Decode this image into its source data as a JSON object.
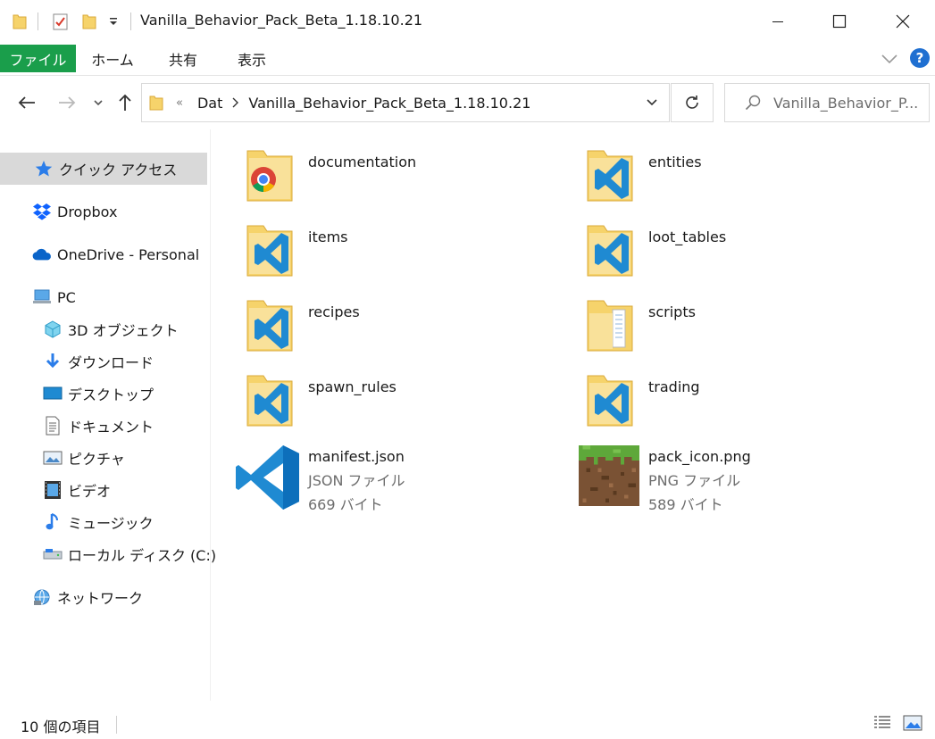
{
  "window": {
    "title": "Vanilla_Behavior_Pack_Beta_1.18.10.21"
  },
  "ribbon": {
    "tabs": [
      "ファイル",
      "ホーム",
      "共有",
      "表示"
    ]
  },
  "address": {
    "overflow": "«",
    "crumbs": [
      "Dat",
      "Vanilla_Behavior_Pack_Beta_1.18.10.21"
    ]
  },
  "search": {
    "placeholder": "Vanilla_Behavior_P..."
  },
  "sidebar": {
    "items": [
      {
        "label": "クイック アクセス",
        "icon": "star-icon"
      },
      {
        "label": "Dropbox",
        "icon": "dropbox-icon"
      },
      {
        "label": "OneDrive - Personal",
        "icon": "onedrive-icon"
      },
      {
        "label": "PC",
        "icon": "pc-icon"
      },
      {
        "label": "3D オブジェクト",
        "icon": "3d-objects-icon"
      },
      {
        "label": "ダウンロード",
        "icon": "download-icon"
      },
      {
        "label": "デスクトップ",
        "icon": "desktop-icon"
      },
      {
        "label": "ドキュメント",
        "icon": "documents-icon"
      },
      {
        "label": "ピクチャ",
        "icon": "pictures-icon"
      },
      {
        "label": "ビデオ",
        "icon": "videos-icon"
      },
      {
        "label": "ミュージック",
        "icon": "music-icon"
      },
      {
        "label": "ローカル ディスク (C:)",
        "icon": "local-disk-icon"
      },
      {
        "label": "ネットワーク",
        "icon": "network-icon"
      }
    ]
  },
  "files": {
    "folders": [
      {
        "name": "documentation",
        "icon": "folder-chrome-icon"
      },
      {
        "name": "entities",
        "icon": "folder-vscode-icon"
      },
      {
        "name": "items",
        "icon": "folder-vscode-icon"
      },
      {
        "name": "loot_tables",
        "icon": "folder-vscode-icon"
      },
      {
        "name": "recipes",
        "icon": "folder-vscode-icon"
      },
      {
        "name": "scripts",
        "icon": "folder-icon"
      },
      {
        "name": "spawn_rules",
        "icon": "folder-vscode-icon"
      },
      {
        "name": "trading",
        "icon": "folder-vscode-icon"
      }
    ],
    "manifest": {
      "name": "manifest.json",
      "type": "JSON ファイル",
      "size": "669 バイト",
      "icon": "vscode-icon"
    },
    "pack_icon": {
      "name": "pack_icon.png",
      "type": "PNG ファイル",
      "size": "589 バイト",
      "icon": "minecraft-grass-icon"
    }
  },
  "status": {
    "count": "10 個の項目"
  },
  "colors": {
    "file_tab": "#1a9e4b",
    "selected": "#d9d9d9",
    "folder": "#f6d36b",
    "vscode_blue": "#1f8ad2",
    "help_blue": "#1f6fd1"
  }
}
